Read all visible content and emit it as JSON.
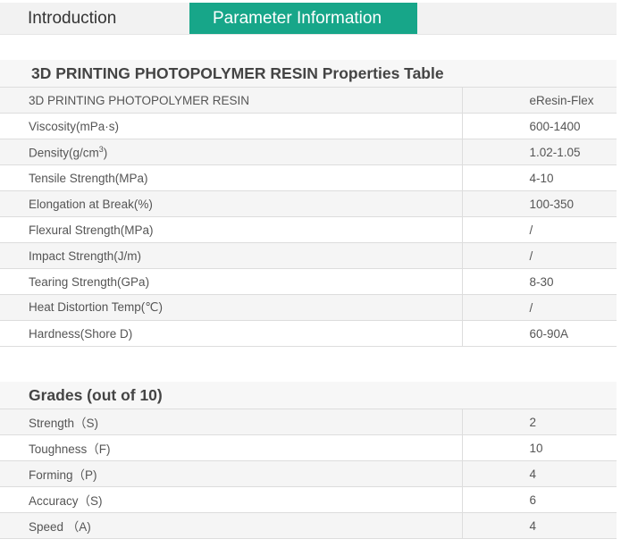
{
  "tabs": {
    "introduction": "Introduction",
    "parameter_information": "Parameter Information"
  },
  "properties": {
    "title": "3D PRINTING PHOTOPOLYMER RESIN Properties Table",
    "header": {
      "name": "3D PRINTING PHOTOPOLYMER RESIN",
      "value": "eResin-Flex"
    },
    "rows": [
      {
        "name": "Viscosity(mPa·s)",
        "value": "600-1400"
      },
      {
        "name": "Density(g/cm",
        "sup": "3",
        "suffix": ")",
        "value": "1.02-1.05"
      },
      {
        "name": "Tensile Strength(MPa)",
        "value": "4-10"
      },
      {
        "name": "Elongation at Break(%)",
        "value": "100-350"
      },
      {
        "name": "Flexural Strength(MPa)",
        "value": "/"
      },
      {
        "name": "Impact Strength(J/m)",
        "value": "/"
      },
      {
        "name": "Tearing Strength(GPa)",
        "value": "8-30"
      },
      {
        "name": "Heat Distortion Temp(℃)",
        "value": "/"
      },
      {
        "name": "Hardness(Shore D)",
        "value": "60-90A"
      }
    ]
  },
  "grades": {
    "title": "Grades (out of 10)",
    "rows": [
      {
        "name": "Strength（S)",
        "value": "2"
      },
      {
        "name": "Toughness（F)",
        "value": "10"
      },
      {
        "name": "Forming（P)",
        "value": "4"
      },
      {
        "name": "Accuracy（S)",
        "value": "6"
      },
      {
        "name": "Speed （A)",
        "value": "4"
      }
    ]
  }
}
